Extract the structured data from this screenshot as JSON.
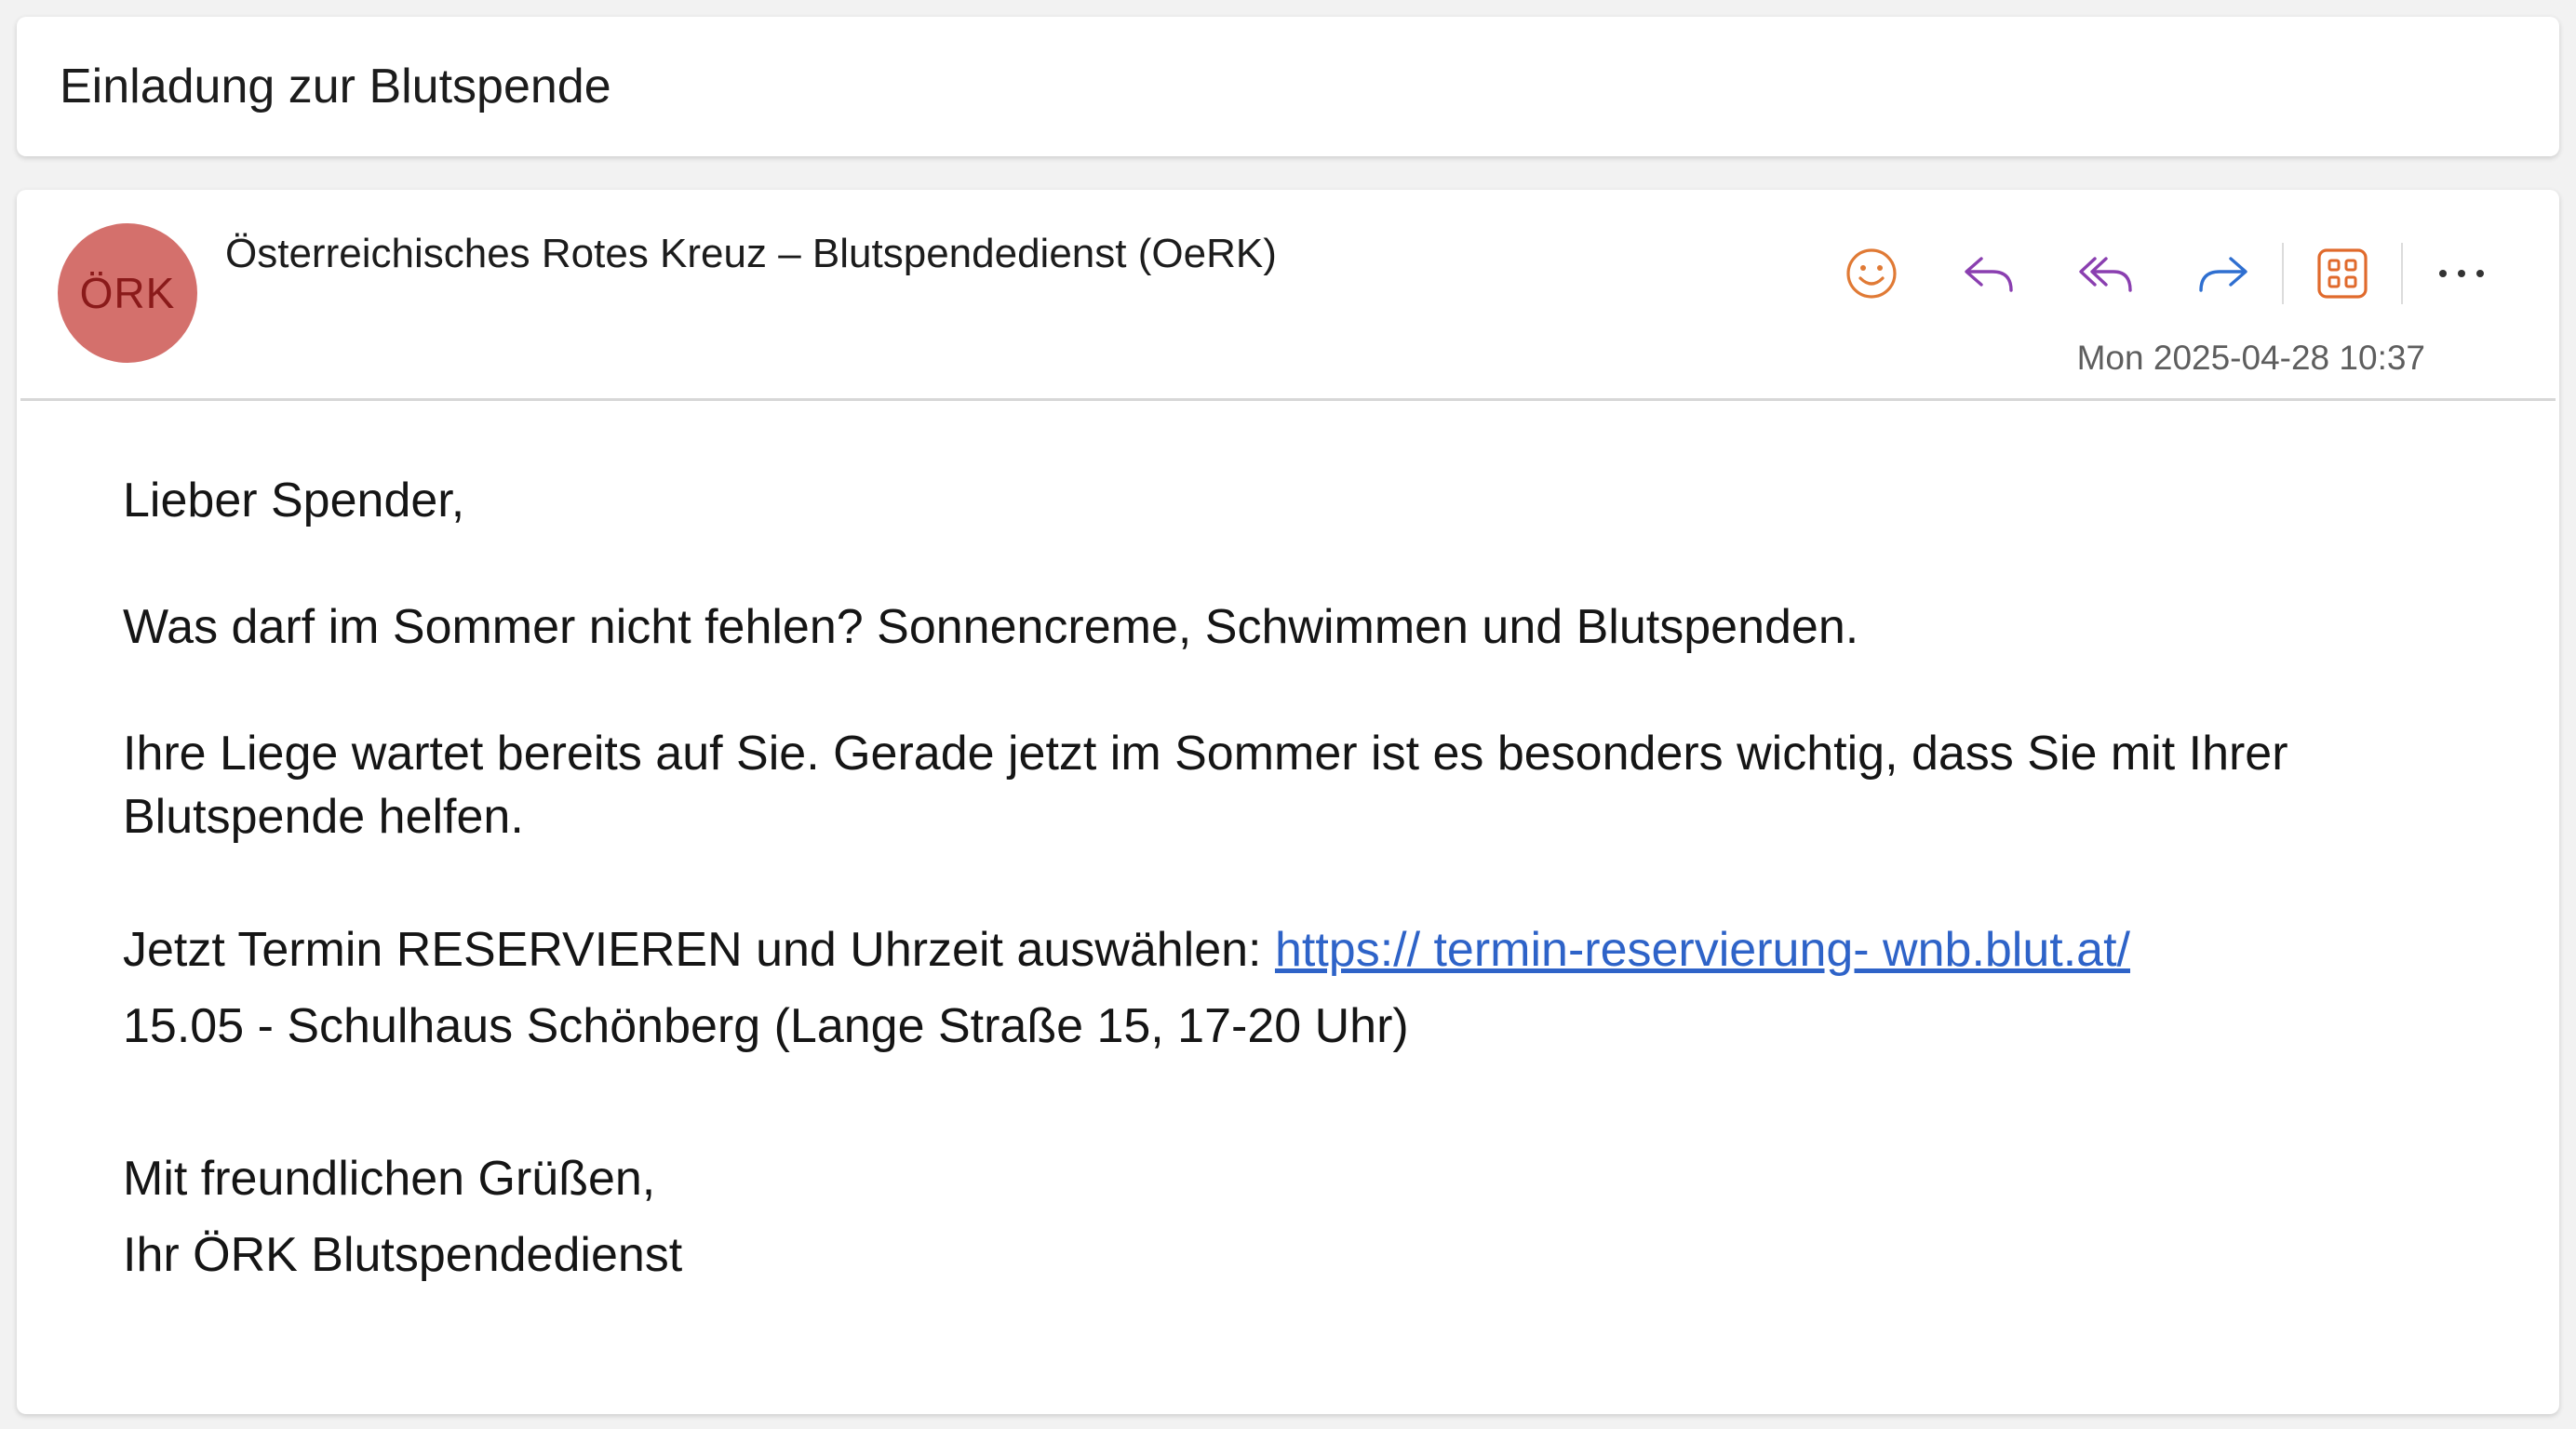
{
  "subject": "Einladung zur Blutspende",
  "sender": {
    "avatar_initials": "ÖRK",
    "name": "Österreichisches Rotes Kreuz – Blutspendedienst (OeRK)"
  },
  "timestamp": "Mon 2025-04-28 10:37",
  "toolbar": {
    "icons": [
      "smiley-icon",
      "reply-icon",
      "reply-all-icon",
      "forward-icon",
      "apps-icon",
      "more-icon"
    ]
  },
  "body": {
    "greeting": "Lieber Spender,",
    "para1": "Was darf im Sommer nicht fehlen? Sonnencreme, Schwimmen und Blutspenden.",
    "para2": "Ihre Liege wartet bereits auf Sie. Gerade jetzt im Sommer ist es besonders wichtig, dass Sie mit Ihrer Blutspende helfen.",
    "cta_text": "Jetzt Termin RESERVIEREN und Uhrzeit auswählen: ",
    "cta_link": "https:// termin-reservierung- wnb.blut.at/",
    "event_line": "15.05 - Schulhaus Schönberg (Lange Straße 15, 17-20 Uhr)",
    "closing": "Mit freundlichen Grüßen,",
    "signature": "Ihr ÖRK Blutspendedienst"
  },
  "colors": {
    "avatar_bg": "#d4706c",
    "avatar_text": "#8a1a1a",
    "smiley": "#e07a35",
    "reply": "#8a3fb0",
    "forward": "#2f6fd0",
    "apps": "#e06a2c",
    "link": "#2e63c8"
  }
}
